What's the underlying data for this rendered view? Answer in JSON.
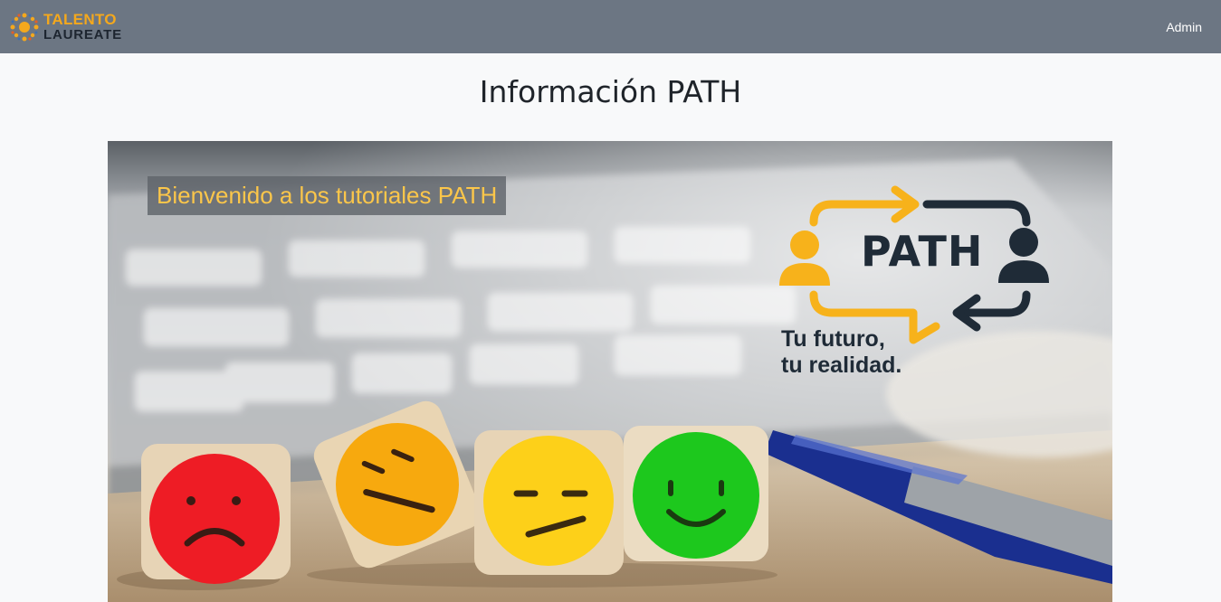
{
  "navbar": {
    "brand_line1": "TALENTO",
    "brand_line2": "LAUREATE",
    "admin_link": "Admin",
    "background": "#6c7683",
    "brand_accent": "#f4a81d"
  },
  "page": {
    "title": "Información PATH"
  },
  "banner": {
    "caption": "Bienvenido a los tutoriales PATH",
    "logo_word": "PATH",
    "tagline_line1": "Tu futuro,",
    "tagline_line2": "tu realidad.",
    "caption_color": "#fbc64a",
    "logo_dark": "#1f2b37",
    "logo_accent": "#f7b21b",
    "icons": [
      "keyboard-photo",
      "sad-face-die",
      "confused-face-die",
      "neutral-face-die",
      "happy-face-die",
      "blue-pen",
      "person-icon",
      "arrow-icon"
    ]
  }
}
